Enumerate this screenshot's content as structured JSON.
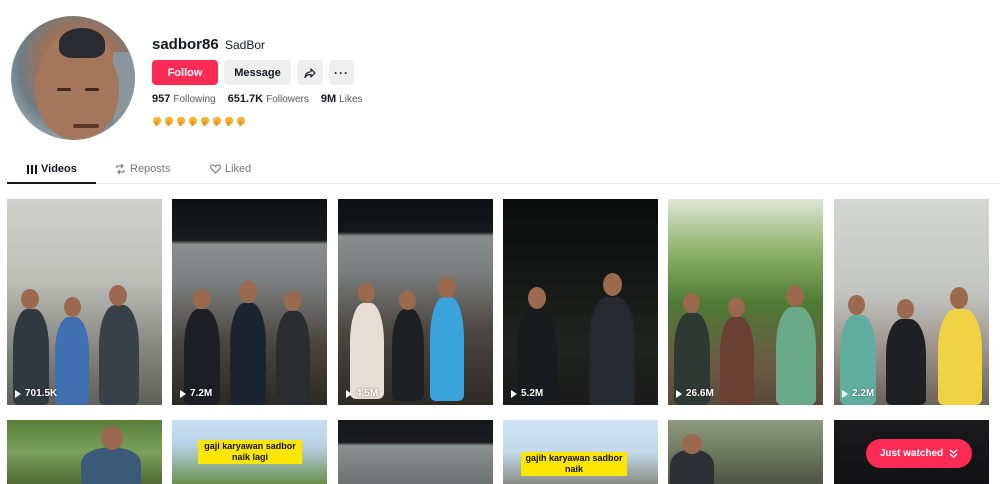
{
  "profile": {
    "username": "sadbor86",
    "nickname": "SadBor",
    "follow_label": "Follow",
    "message_label": "Message",
    "more_label": "···",
    "stats": [
      {
        "value": "957",
        "label": "Following"
      },
      {
        "value": "651.7K",
        "label": "Followers"
      },
      {
        "value": "9M",
        "label": "Likes"
      }
    ],
    "bio_icons": [
      "hand-pointing-down-icon",
      "hand-pointing-down-icon",
      "hand-pointing-down-icon",
      "hand-pointing-down-icon",
      "hand-pointing-down-icon",
      "hand-pointing-down-icon",
      "hand-pointing-down-icon",
      "hand-pointing-down-icon"
    ]
  },
  "tabs": [
    {
      "label": "Videos",
      "icon": "grid-icon",
      "active": true
    },
    {
      "label": "Reposts",
      "icon": "repost-icon",
      "active": false
    },
    {
      "label": "Liked",
      "icon": "heart-icon",
      "active": false
    }
  ],
  "videos": [
    {
      "views": "701.5K"
    },
    {
      "views": "7.2M"
    },
    {
      "views": "4.5M"
    },
    {
      "views": "5.2M"
    },
    {
      "views": "26.6M"
    },
    {
      "views": "2.2M"
    }
  ],
  "videos_row2": [
    {
      "caption": ""
    },
    {
      "caption": "gaji karyawan sadbor naik lagi"
    },
    {
      "caption": ""
    },
    {
      "caption": "gajih karyawan sadbor naik"
    },
    {
      "caption": ""
    },
    {
      "caption": ""
    }
  ],
  "just_watched_label": "Just watched",
  "colors": {
    "accent": "#fe2c55",
    "text": "#161823",
    "muted": "#73747b",
    "button_bg": "#eeeeef"
  }
}
